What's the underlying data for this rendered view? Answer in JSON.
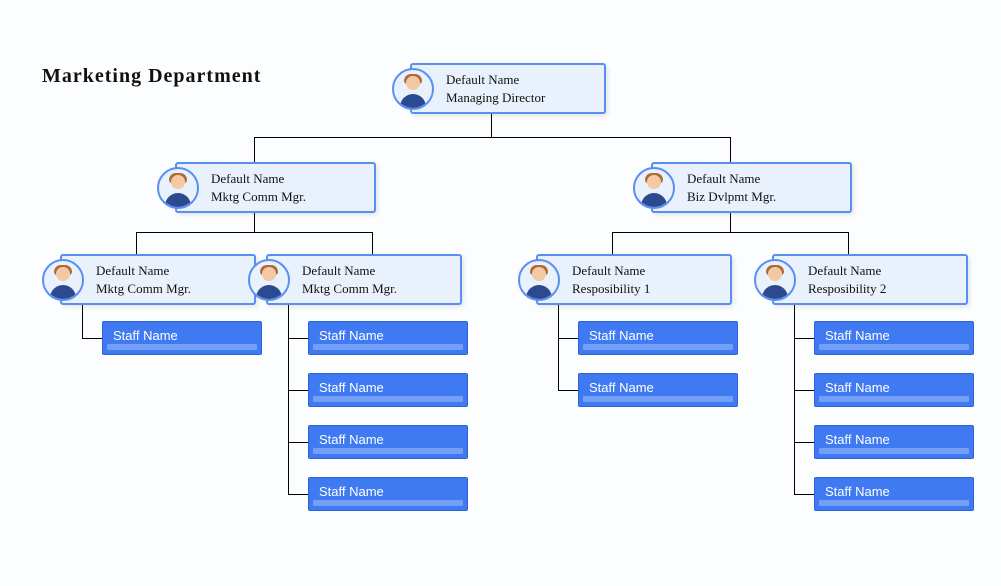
{
  "title": "Marketing Department",
  "root": {
    "name": "Default Name",
    "role": "Managing Director"
  },
  "mgrL": {
    "name": "Default Name",
    "role": "Mktg Comm Mgr."
  },
  "mgrR": {
    "name": "Default Name",
    "role": "Biz Dvlpmt Mgr."
  },
  "sub": {
    "a": {
      "name": "Default Name",
      "role": "Mktg Comm Mgr."
    },
    "b": {
      "name": "Default Name",
      "role": "Mktg Comm Mgr."
    },
    "c": {
      "name": "Default Name",
      "role": "Resposibility 1"
    },
    "d": {
      "name": "Default Name",
      "role": "Resposibility 2"
    }
  },
  "staff": {
    "a": [
      "Staff Name"
    ],
    "b": [
      "Staff Name",
      "Staff Name",
      "Staff Name",
      "Staff Name"
    ],
    "c": [
      "Staff Name",
      "Staff Name"
    ],
    "d": [
      "Staff Name",
      "Staff Name",
      "Staff Name",
      "Staff Name"
    ]
  }
}
